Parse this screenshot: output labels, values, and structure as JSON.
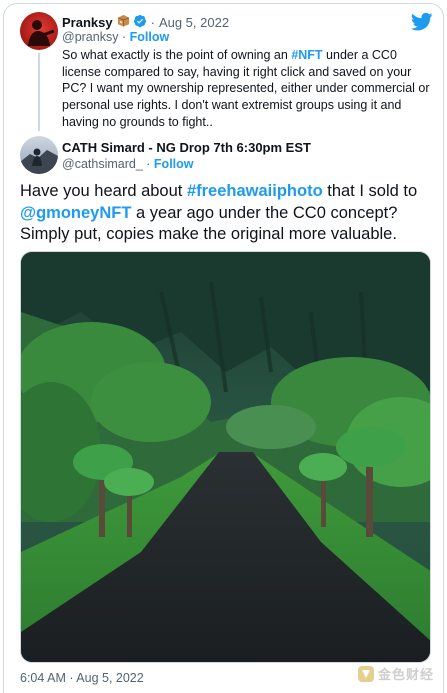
{
  "tweet1": {
    "display_name": "Pranksy",
    "box_emoji": "📦",
    "date": "Aug 5, 2022",
    "handle": "@pranksy",
    "follow": "Follow",
    "text_parts": [
      "So what exactly is the point of owning an ",
      "#NFT",
      " under a CC0 license compared to say, having it right click and saved on your PC? I want my ownership represented, either under commercial or personal use rights. I don't want extremist groups using it and having no grounds to fight.."
    ]
  },
  "tweet2": {
    "display_name": "CATH Simard - NG Drop 7th 6:30pm EST",
    "handle": "@cathsimard_",
    "follow": "Follow",
    "text_parts": [
      "Have you heard about ",
      "#freehawaiiphoto",
      " that I sold to ",
      "@gmoneyNFT",
      " a year ago under the CC0 concept? Simply put, copies make the original more valuable."
    ],
    "photo_icon": "hawaii-road-photo",
    "timestamp": "6:04 AM · Aug 5, 2022"
  },
  "separator": "·",
  "watermark": {
    "text": "金色财经",
    "icon": "jinse-logo-icon"
  },
  "colors": {
    "link": "#1d9bf0",
    "muted": "#536471",
    "text": "#0f1419",
    "border": "#cfd9de"
  }
}
